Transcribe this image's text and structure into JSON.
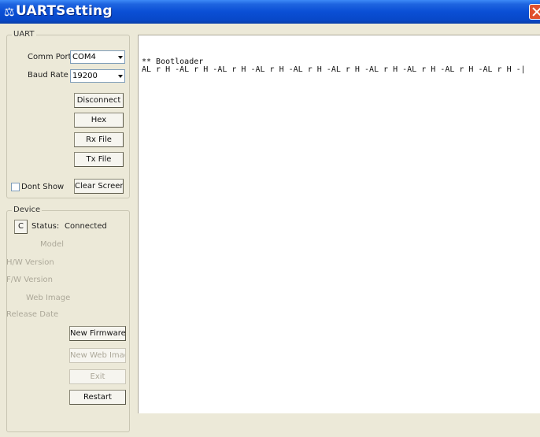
{
  "window": {
    "title": "UARTSetting",
    "icon": "app-icon",
    "close_icon": "close-icon"
  },
  "uart": {
    "group_label": "UART",
    "comm_port_label": "Comm Port",
    "comm_port_value": "COM4",
    "baud_rate_label": "Baud Rate",
    "baud_rate_value": "19200",
    "disconnect_label": "Disconnect",
    "hex_label": "Hex",
    "rx_file_label": "Rx File",
    "tx_file_label": "Tx File",
    "dont_show_label": "Dont Show",
    "dont_show_checked": false,
    "clear_screen_label": "Clear Screen"
  },
  "device": {
    "group_label": "Device",
    "c_button_label": "C",
    "status_label": "Status:",
    "status_value": "Connected",
    "model_label": "Model",
    "hw_version_label": "H/W Version",
    "fw_version_label": "F/W Version",
    "web_image_label": "Web Image",
    "release_date_label": "Release Date",
    "new_firmware_label": "New Firmware",
    "new_web_image_label": "New Web Image",
    "exit_label": "Exit",
    "restart_label": "Restart"
  },
  "console": {
    "lines": [
      "** Bootloader",
      "AL r  H -AL r  H -AL r  H -AL r  H -AL r  H -AL r  H -AL r  H -AL r  H -AL r  H -AL r  H -|"
    ]
  }
}
